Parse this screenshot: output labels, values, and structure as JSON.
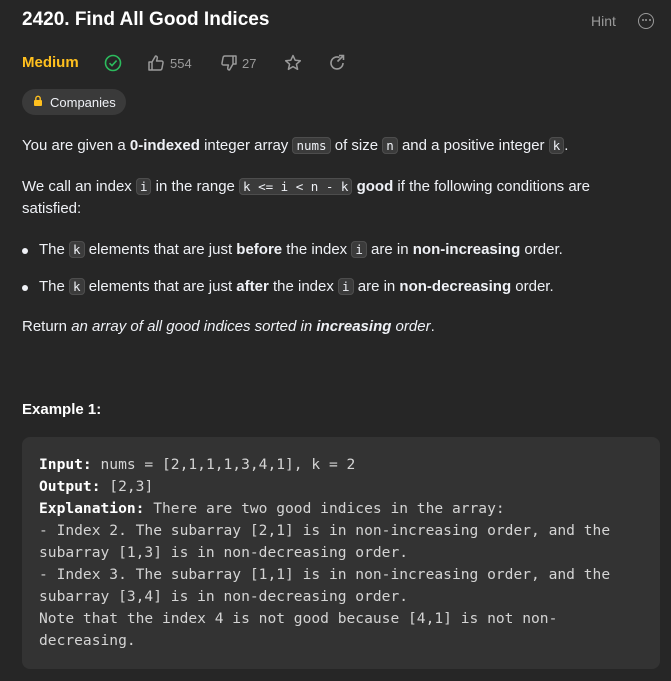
{
  "header": {
    "title": "2420. Find All Good Indices",
    "hint_label": "Hint"
  },
  "meta": {
    "difficulty": "Medium",
    "likes": "554",
    "dislikes": "27",
    "companies_label": "Companies",
    "colors": {
      "difficulty": "#ffc01e",
      "solved": "#2cbb5d"
    }
  },
  "description": {
    "p1": [
      "You are given a ",
      "0-indexed",
      " integer array ",
      "nums",
      " of size ",
      "n",
      " and a positive integer ",
      "k",
      "."
    ],
    "p2_line1": [
      "We call an index ",
      "i",
      " in the range ",
      "k <= i < n - k",
      " ",
      "good",
      " if the following conditions are"
    ],
    "p2_line2": "satisfied:",
    "bullet1": [
      "The ",
      "k",
      " elements that are just ",
      "before",
      " the index ",
      "i",
      " are in ",
      "non-increasing",
      " order."
    ],
    "bullet2": [
      "The ",
      "k",
      " elements that are just ",
      "after",
      " the index ",
      "i",
      " are in ",
      "non-decreasing",
      " order."
    ],
    "p3": [
      "Return ",
      "an array of all good indices sorted in ",
      "increasing",
      " order",
      "."
    ]
  },
  "example": {
    "title": "Example 1:",
    "input_label": "Input:",
    "input_value": " nums = [2,1,1,1,3,4,1], k = 2",
    "output_label": "Output:",
    "output_value": " [2,3]",
    "explanation_label": "Explanation:",
    "explanation_lines": [
      " There are two good indices in the array:",
      "- Index 2. The subarray [2,1] is in non-increasing order, and the",
      "subarray [1,3] is in non-decreasing order.",
      "- Index 3. The subarray [1,1] is in non-increasing order, and the",
      "subarray [3,4] is in non-decreasing order.",
      "Note that the index 4 is not good because [4,1] is not non-",
      "decreasing."
    ]
  },
  "icons": {
    "solved": "check-circle-icon",
    "like": "thumbs-up-icon",
    "dislike": "thumbs-down-icon",
    "star": "star-icon",
    "share": "share-icon",
    "lock": "lock-icon",
    "more": "more-options-icon"
  }
}
